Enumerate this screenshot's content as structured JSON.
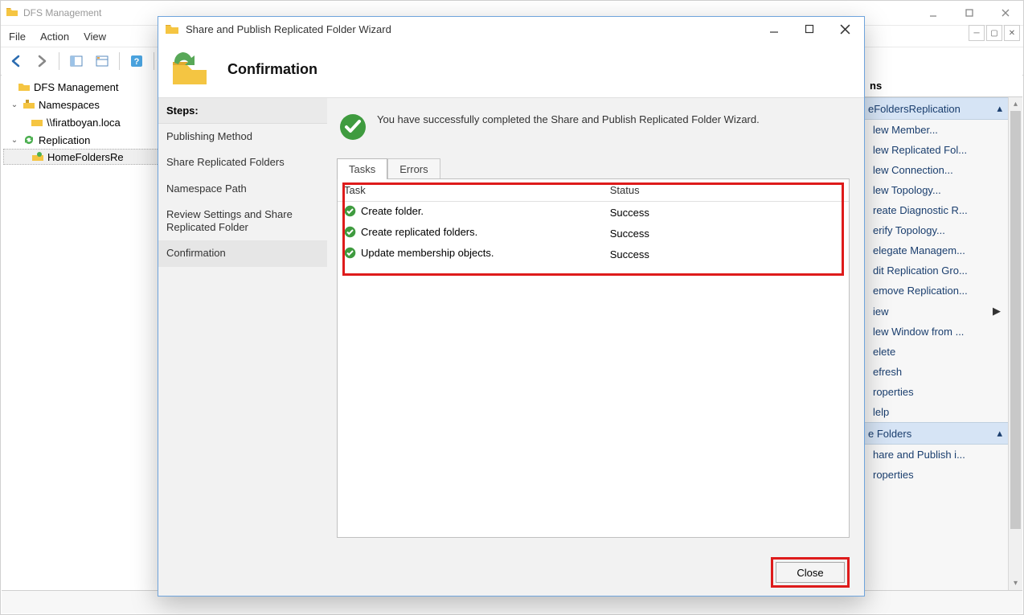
{
  "main_window": {
    "title": "DFS Management",
    "menu": {
      "file": "File",
      "action": "Action",
      "view": "View"
    }
  },
  "tree": {
    "root": "DFS Management",
    "namespaces": "Namespaces",
    "namespace_item": "\\\\firatboyan.loca",
    "replication": "Replication",
    "replication_item": "HomeFoldersRe"
  },
  "actions_pane": {
    "title": "ns",
    "group1": "eFoldersReplication",
    "items1": [
      "lew Member...",
      "lew Replicated Fol...",
      "lew Connection...",
      "lew Topology...",
      "reate Diagnostic R...",
      "erify Topology...",
      "elegate Managem...",
      "dit Replication Gro...",
      "emove Replication...",
      "iew",
      "lew Window from ...",
      "elete",
      "efresh",
      "roperties",
      "lelp"
    ],
    "group2": "e Folders",
    "items2": [
      "hare and Publish i...",
      "roperties"
    ]
  },
  "dialog": {
    "title": "Share and Publish Replicated Folder Wizard",
    "heading": "Confirmation",
    "steps_label": "Steps:",
    "steps": [
      "Publishing Method",
      "Share Replicated Folders",
      "Namespace Path",
      "Review Settings and Share Replicated Folder",
      "Confirmation"
    ],
    "success_message": "You have successfully completed the Share and Publish Replicated Folder Wizard.",
    "tabs": {
      "tasks": "Tasks",
      "errors": "Errors"
    },
    "table": {
      "col_task": "Task",
      "col_status": "Status",
      "rows": [
        {
          "task": "Create folder.",
          "status": "Success"
        },
        {
          "task": "Create replicated folders.",
          "status": "Success"
        },
        {
          "task": "Update membership objects.",
          "status": "Success"
        }
      ]
    },
    "close": "Close"
  }
}
